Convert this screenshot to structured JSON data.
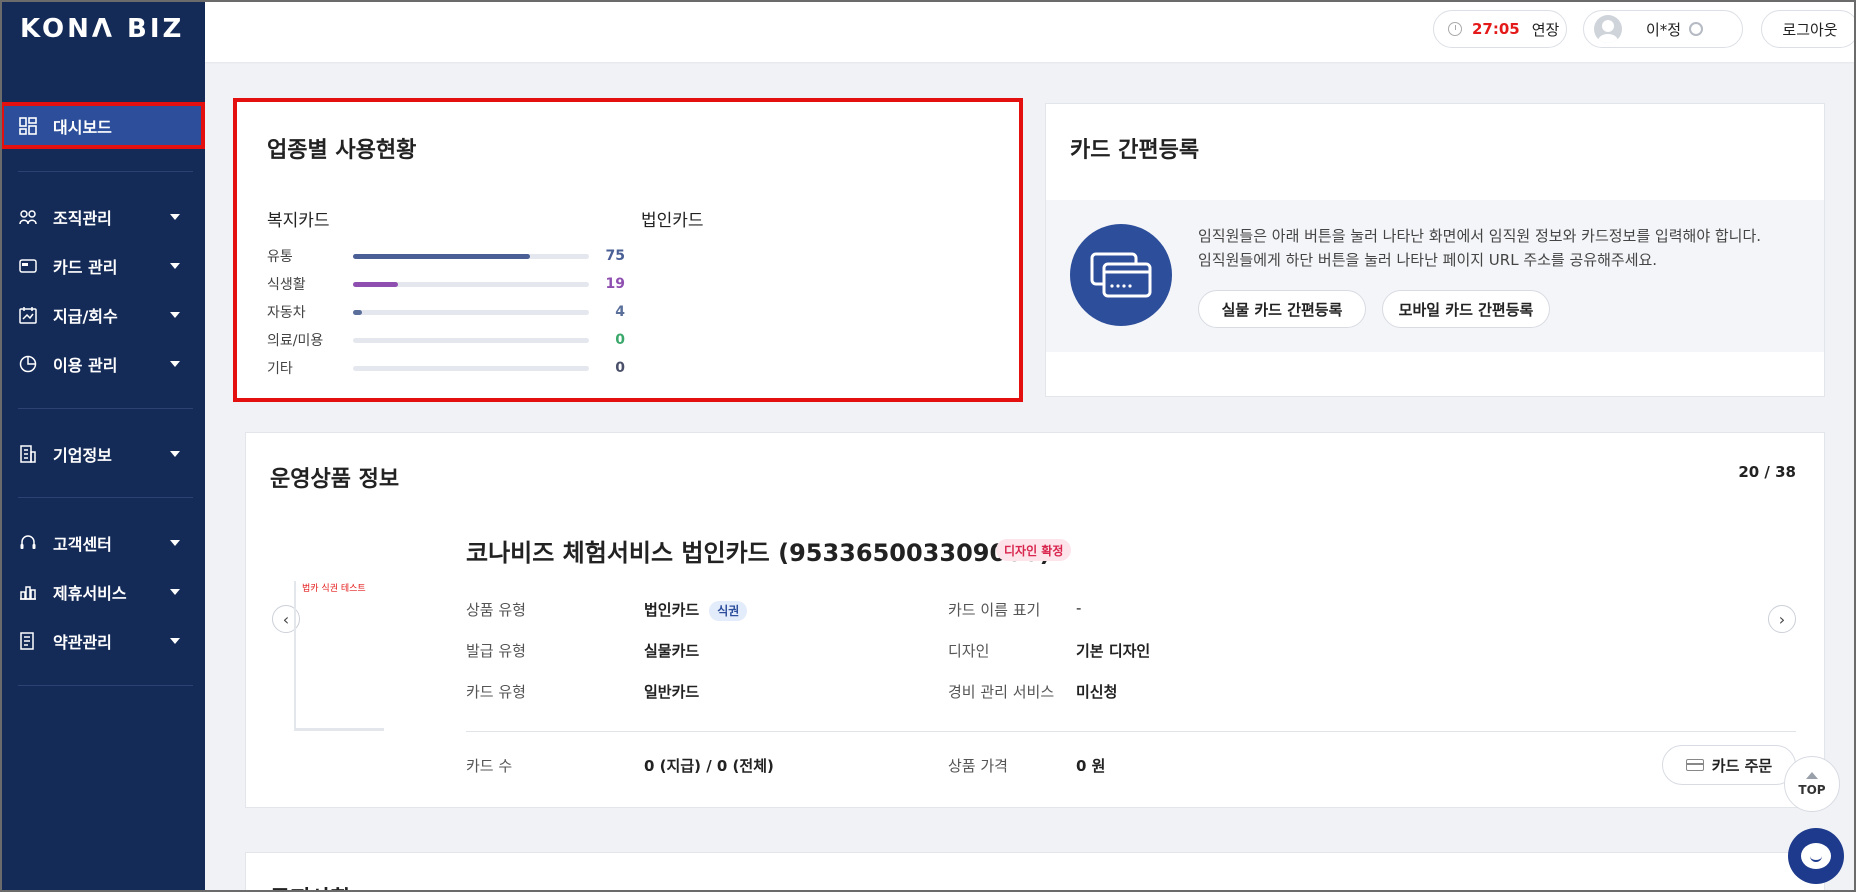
{
  "brand": {
    "logo": "KONΛ BIZ"
  },
  "sidebar": {
    "items": [
      {
        "label": "대시보드",
        "icon": "dashboard-icon"
      },
      {
        "label": "조직관리",
        "icon": "organization-icon"
      },
      {
        "label": "카드 관리",
        "icon": "card-icon"
      },
      {
        "label": "지급/회수",
        "icon": "payment-icon"
      },
      {
        "label": "이용 관리",
        "icon": "usage-icon"
      },
      {
        "label": "기업정보",
        "icon": "building-icon"
      },
      {
        "label": "고객센터",
        "icon": "headset-icon"
      },
      {
        "label": "제휴서비스",
        "icon": "partner-icon"
      },
      {
        "label": "약관관리",
        "icon": "document-icon"
      }
    ]
  },
  "topbar": {
    "timer": "27:05",
    "extend_label": "연장",
    "user_name": "이*정",
    "logout_label": "로그아웃"
  },
  "usage": {
    "title": "업종별 사용현황",
    "welfare_label": "복지카드",
    "corporate_label": "법인카드",
    "rows": [
      {
        "name": "유통",
        "value": "75",
        "color": "#4a5f96"
      },
      {
        "name": "식생활",
        "value": "19",
        "color": "#8f4fb0"
      },
      {
        "name": "자동차",
        "value": "4",
        "color": "#5a6f9a"
      },
      {
        "name": "의료/미용",
        "value": "0",
        "color": "#3aa86b"
      },
      {
        "name": "기타",
        "value": "0",
        "color": "#4a4f6a"
      }
    ]
  },
  "quick_register": {
    "title": "카드 간편등록",
    "desc_line1": "임직원들은 아래 버튼을 눌러 나타난 화면에서 임직원 정보와 카드정보를 입력해야 합니다.",
    "desc_line2": "임직원들에게 하단 버튼을 눌러 나타난 페이지 URL 주소를 공유해주세요.",
    "physical_button": "실물 카드 간편등록",
    "mobile_button": "모바일 카드 간편등록"
  },
  "product": {
    "title": "운영상품 정보",
    "page_count": "20 / 38",
    "thumb_label": "법카 식권 테스트",
    "name": "코나비즈 체험서비스 법인카드 (953365003309000)",
    "status_badge": "디자인 확정",
    "fields": {
      "product_type_label": "상품 유형",
      "product_type_value": "법인카드",
      "product_type_badge": "식권",
      "issue_type_label": "발급 유형",
      "issue_type_value": "실물카드",
      "card_type_label": "카드 유형",
      "card_type_value": "일반카드",
      "name_display_label": "카드 이름 표기",
      "name_display_value": "-",
      "design_label": "디자인",
      "design_value": "기본 디자인",
      "expense_label": "경비 관리 서비스",
      "expense_value": "미신청",
      "card_count_label": "카드 수",
      "card_count_value": "0 (지급) / 0 (전체)",
      "price_label": "상품 가격",
      "price_value": "0 원"
    },
    "order_button": "카드 주문"
  },
  "bottom_card": {
    "title": "공지사항"
  },
  "floating": {
    "top_label": "TOP"
  }
}
